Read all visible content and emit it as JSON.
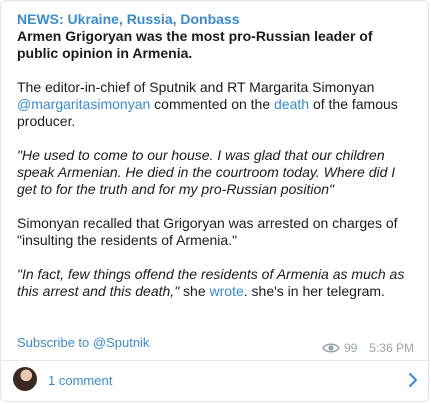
{
  "post": {
    "channel_tag": "NEWS: Ukraine, Russia, Donbass",
    "headline": "Armen Grigoryan was the most pro-Russian leader of public opinion in Armenia.",
    "para1": {
      "prefix": "The editor-in-chief of Sputnik and RT Margarita Simonyan ",
      "mention": "@margaritasimonyan",
      "middle": " commented on the ",
      "link": "death",
      "suffix": " of the famous producer."
    },
    "quote1": "\"He used to come to our house. I was glad that our children speak Armenian. He died in the courtroom today. Where did I get to for the truth and for my pro-Russian position\"",
    "para3": "Simonyan recalled that Grigoryan was arrested on charges of \"insulting the residents of Armenia.\"",
    "para4": {
      "quote": " \"In fact, few things offend the residents of Armenia as much as this arrest and this death,\"",
      "mid": " she ",
      "link": "wrote",
      "suffix": ". she's in her telegram."
    },
    "subscribe_label": "Subscribe to @Sputnik",
    "views": "99",
    "time": "5:36 PM"
  },
  "comments": {
    "label": "1 comment"
  },
  "icons": {
    "views": "eye-icon",
    "comments_arrow": "chevron-right-icon"
  },
  "colors": {
    "accent": "#3a8bc7",
    "meta": "#9aa4ad",
    "text": "#1b1b1b"
  }
}
